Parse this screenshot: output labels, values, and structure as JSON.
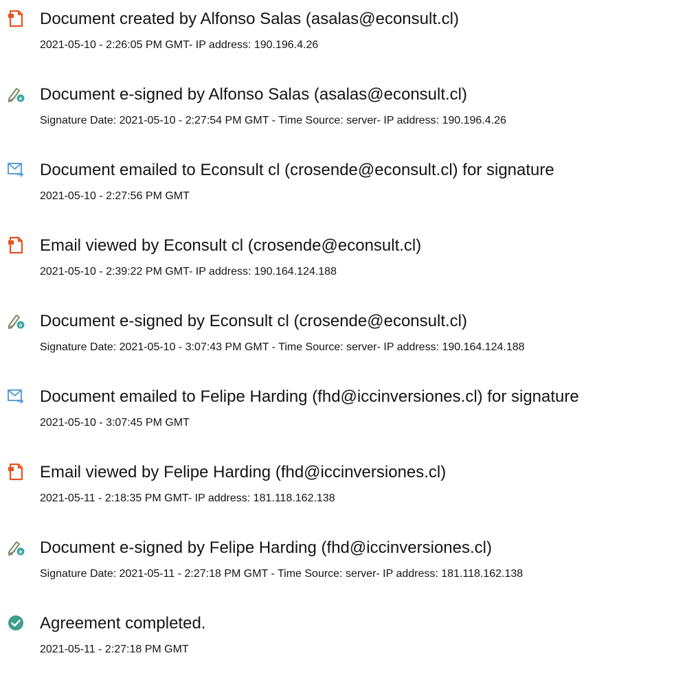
{
  "colors": {
    "document_icon": "#E8521E",
    "sign_pen": "#7B8B6A",
    "sign_badge": "#3FA7A0",
    "email_icon": "#5AA0DA",
    "complete_icon": "#3E9E8C"
  },
  "entries": [
    {
      "icon": "document-icon",
      "event": "Document created by Alfonso Salas (asalas@econsult.cl)",
      "detail": "2021-05-10 - 2:26:05 PM GMT- IP address: 190.196.4.26"
    },
    {
      "icon": "e-sign-icon",
      "event": "Document e-signed by Alfonso Salas (asalas@econsult.cl)",
      "detail": "Signature Date: 2021-05-10 - 2:27:54 PM GMT - Time Source: server- IP address: 190.196.4.26"
    },
    {
      "icon": "email-sent-icon",
      "event": "Document emailed to Econsult cl (crosende@econsult.cl) for signature",
      "detail": "2021-05-10 - 2:27:56 PM GMT"
    },
    {
      "icon": "document-icon",
      "event": "Email viewed by Econsult cl (crosende@econsult.cl)",
      "detail": "2021-05-10 - 2:39:22 PM GMT- IP address: 190.164.124.188"
    },
    {
      "icon": "e-sign-icon",
      "event": "Document e-signed by Econsult cl (crosende@econsult.cl)",
      "detail": "Signature Date: 2021-05-10 - 3:07:43 PM GMT - Time Source: server- IP address: 190.164.124.188"
    },
    {
      "icon": "email-sent-icon",
      "event": "Document emailed to Felipe Harding (fhd@iccinversiones.cl) for signature",
      "detail": "2021-05-10 - 3:07:45 PM GMT"
    },
    {
      "icon": "document-icon",
      "event": "Email viewed by Felipe Harding (fhd@iccinversiones.cl)",
      "detail": "2021-05-11 - 2:18:35 PM GMT- IP address: 181.118.162.138"
    },
    {
      "icon": "e-sign-icon",
      "event": "Document e-signed by Felipe Harding (fhd@iccinversiones.cl)",
      "detail": "Signature Date: 2021-05-11 - 2:27:18 PM GMT - Time Source: server- IP address: 181.118.162.138"
    },
    {
      "icon": "checkmark-circle-icon",
      "event": "Agreement completed.",
      "detail": "2021-05-11 - 2:27:18 PM GMT"
    }
  ]
}
